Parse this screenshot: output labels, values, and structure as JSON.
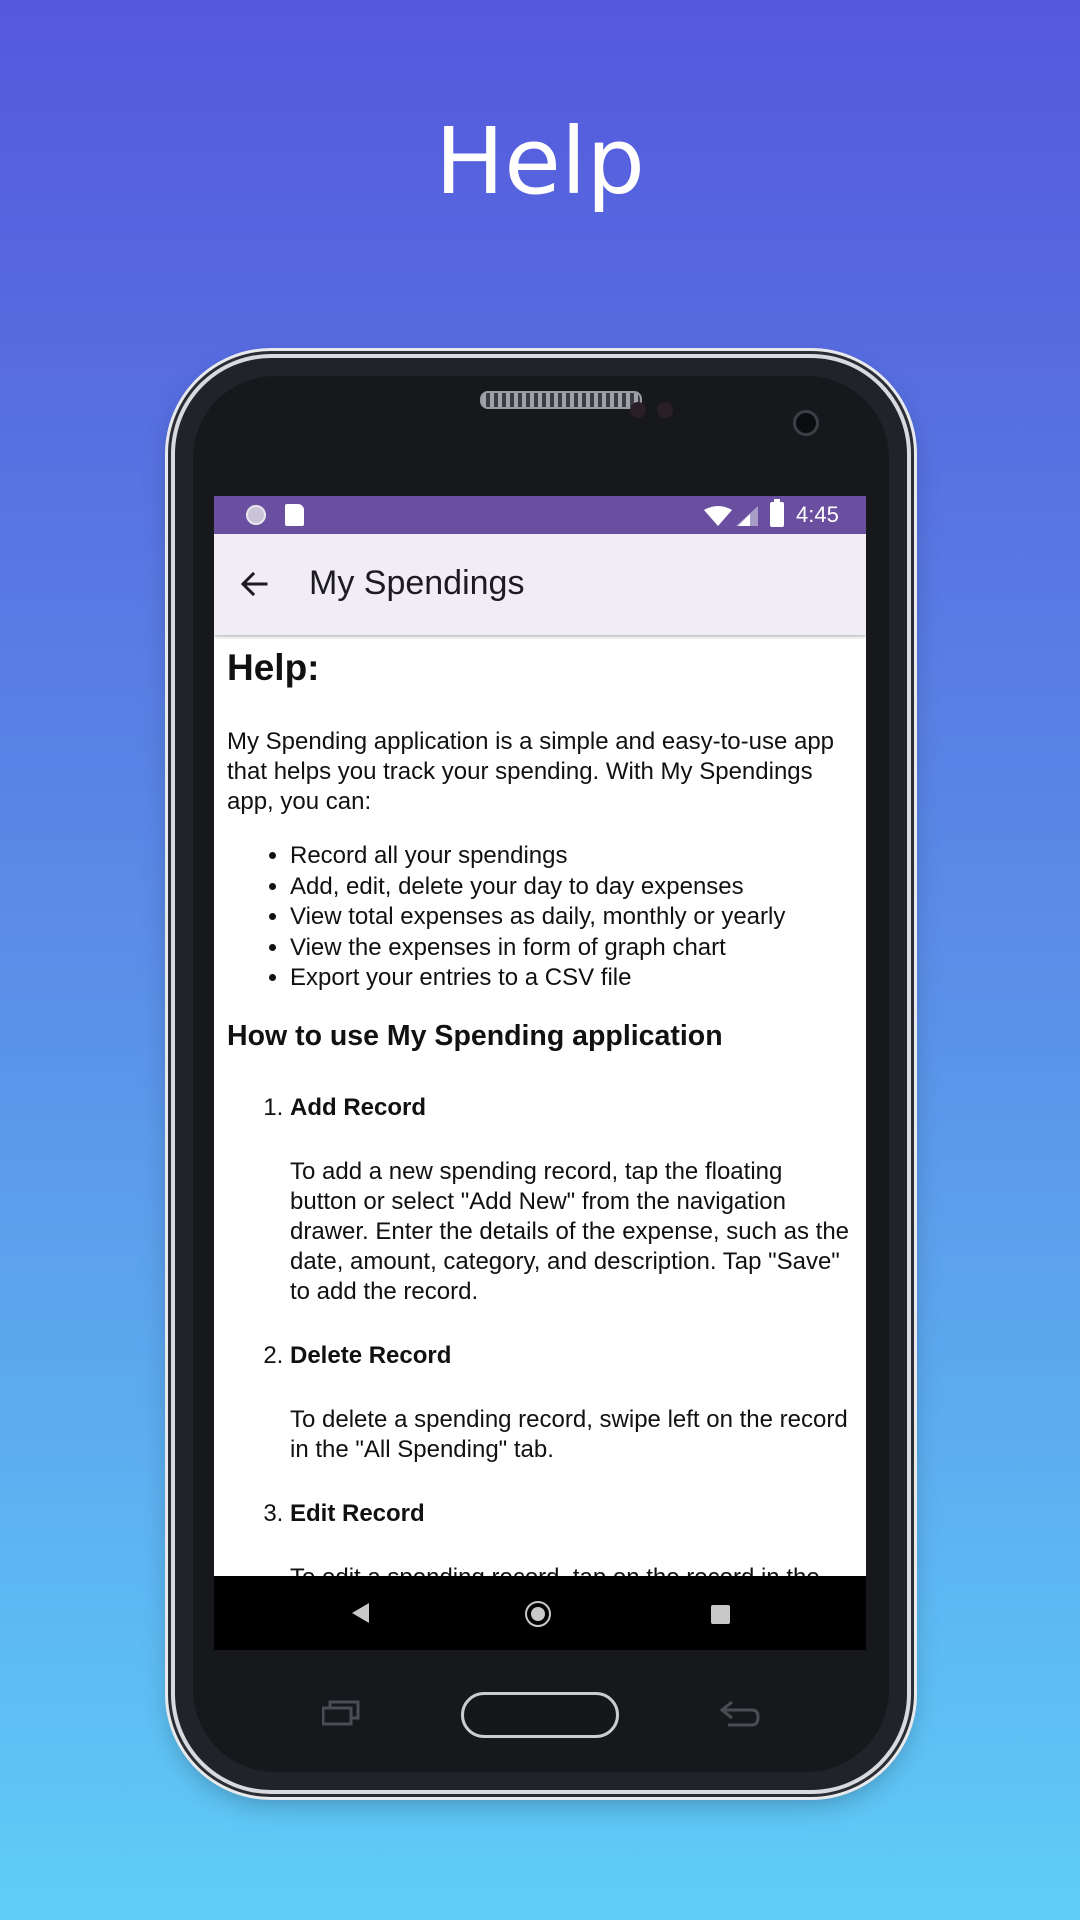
{
  "promo": {
    "title": "Help"
  },
  "statusbar": {
    "time": "4:45"
  },
  "appbar": {
    "title": "My Spendings"
  },
  "help": {
    "heading": "Help:",
    "intro": "My Spending application is a simple and easy-to-use app that helps you track your spending. With My Spendings app, you can:",
    "features": [
      "Record all your spendings",
      "Add, edit, delete your day to day expenses",
      "View total expenses as daily, monthly or yearly",
      "View the expenses in form of graph chart",
      "Export your entries to a CSV file"
    ],
    "howto_heading": "How to use My Spending application",
    "steps": [
      {
        "title": "Add Record",
        "desc": "To add a new spending record, tap the floating button or select \"Add New\" from the navigation drawer. Enter the details of the expense, such as the date, amount, category, and description. Tap \"Save\" to add the record."
      },
      {
        "title": "Delete Record",
        "desc": "To delete a spending record, swipe left on the record in the \"All Spending\" tab."
      },
      {
        "title": "Edit Record",
        "desc": "To edit a spending record, tap on the record in the"
      }
    ]
  },
  "icons": {
    "back": "arrow-back-icon",
    "status_left": [
      "notification-dot-icon",
      "sd-card-icon"
    ],
    "status_right": [
      "wifi-icon",
      "signal-icon",
      "battery-icon"
    ],
    "nav": [
      "nav-back-icon",
      "nav-home-icon",
      "nav-recents-icon"
    ]
  },
  "colors": {
    "statusbar": "#6a4fa0",
    "appbar": "#f1ecf6",
    "gradient_top": "#5558dc",
    "gradient_bottom": "#5fcdf8"
  }
}
